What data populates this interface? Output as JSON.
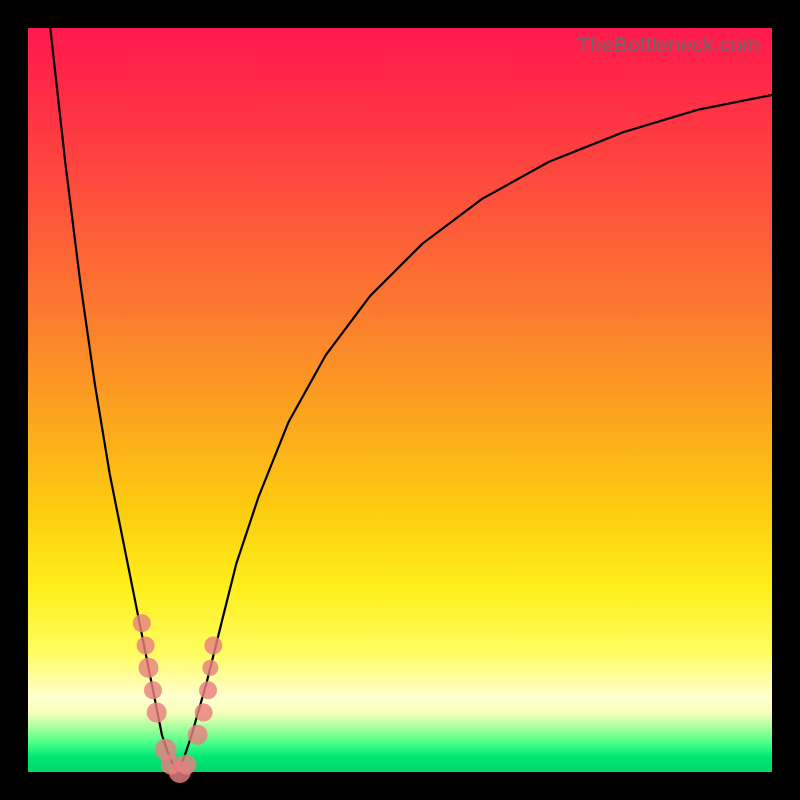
{
  "watermark": "TheBottleneck.com",
  "colors": {
    "frame": "#000000",
    "curve": "#000000",
    "dot": "#e88080"
  },
  "chart_data": {
    "type": "line",
    "title": "",
    "xlabel": "",
    "ylabel": "",
    "xlim": [
      0,
      100
    ],
    "ylim": [
      0,
      100
    ],
    "grid": false,
    "series": [
      {
        "name": "bottleneck-curve",
        "note": "V-shaped curve with minimum near x≈20; y estimated as percent of plot height from top (0=top, 100=bottom)",
        "x": [
          3,
          5,
          7,
          9,
          11,
          13,
          15,
          17,
          18,
          19,
          20,
          21,
          22,
          24,
          26,
          28,
          31,
          35,
          40,
          46,
          53,
          61,
          70,
          80,
          90,
          100
        ],
        "y": [
          0,
          18,
          34,
          48,
          60,
          70,
          80,
          90,
          95,
          98,
          100,
          98,
          95,
          88,
          80,
          72,
          63,
          53,
          44,
          36,
          29,
          23,
          18,
          14,
          11,
          9
        ]
      }
    ],
    "points": {
      "name": "overlay-dots",
      "note": "salmon dots clustered on both flanks of the valley near the bottom",
      "x": [
        15.3,
        15.8,
        16.2,
        16.8,
        17.3,
        18.5,
        19.2,
        20.4,
        21.3,
        22.8,
        23.6,
        24.2,
        24.5,
        24.9
      ],
      "y": [
        80,
        83,
        86,
        89,
        92,
        97,
        99,
        100,
        99,
        95,
        92,
        89,
        86,
        83
      ],
      "r": [
        9,
        9,
        10,
        9,
        10,
        11,
        10,
        11,
        10,
        10,
        9,
        9,
        8,
        9
      ]
    }
  }
}
